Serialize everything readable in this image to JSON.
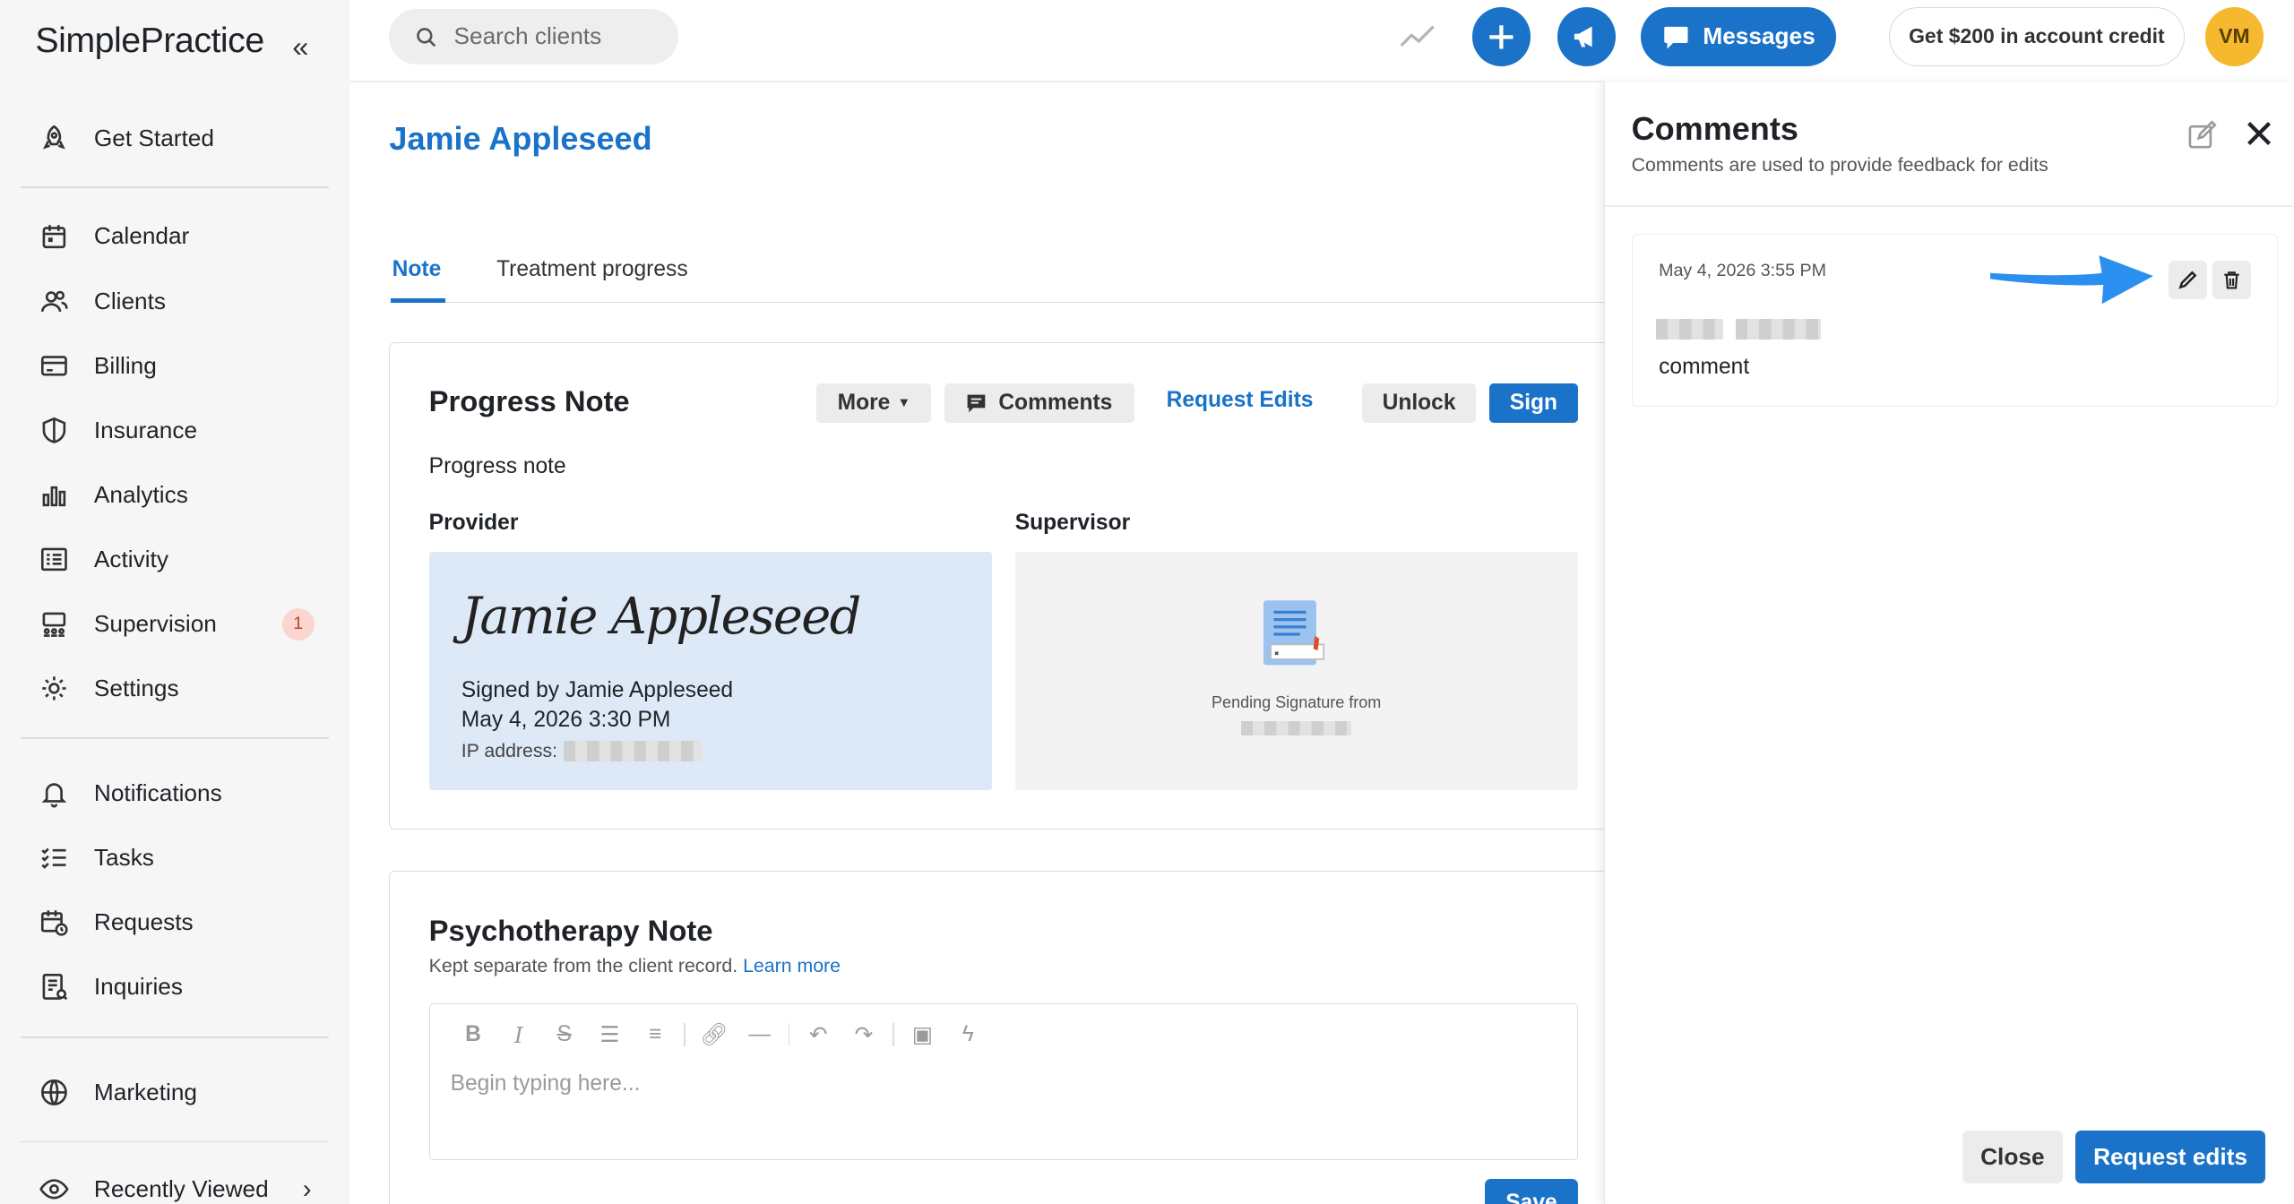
{
  "app": {
    "logo_text": "SimplePractice"
  },
  "sidebar": {
    "items": [
      {
        "label": "Get Started",
        "icon": "rocket-icon"
      },
      {
        "label": "Calendar",
        "icon": "calendar-icon"
      },
      {
        "label": "Clients",
        "icon": "users-icon"
      },
      {
        "label": "Billing",
        "icon": "credit-card-icon"
      },
      {
        "label": "Insurance",
        "icon": "shield-icon"
      },
      {
        "label": "Analytics",
        "icon": "bar-chart-icon"
      },
      {
        "label": "Activity",
        "icon": "list-icon"
      },
      {
        "label": "Supervision",
        "icon": "supervision-icon",
        "badge": "1"
      },
      {
        "label": "Settings",
        "icon": "gear-icon"
      },
      {
        "label": "Notifications",
        "icon": "bell-icon"
      },
      {
        "label": "Tasks",
        "icon": "checklist-icon"
      },
      {
        "label": "Requests",
        "icon": "calendar-clock-icon"
      },
      {
        "label": "Inquiries",
        "icon": "inquiry-icon"
      },
      {
        "label": "Marketing",
        "icon": "globe-icon"
      },
      {
        "label": "Recently Viewed",
        "icon": "eye-icon"
      }
    ]
  },
  "topbar": {
    "search_placeholder": "Search clients",
    "messages_label": "Messages",
    "credit_label": "Get $200 in account credit",
    "avatar_initials": "VM"
  },
  "client": {
    "name": "Jamie Appleseed"
  },
  "tabs": [
    {
      "label": "Note"
    },
    {
      "label": "Treatment progress"
    }
  ],
  "progress_note": {
    "title": "Progress Note",
    "more_label": "More",
    "comments_label": "Comments",
    "request_edits_label": "Request Edits",
    "unlock_label": "Unlock",
    "sign_label": "Sign",
    "subtitle": "Progress note",
    "provider_label": "Provider",
    "supervisor_label": "Supervisor",
    "signature_script": "Jamie Appleseed",
    "signed_by": "Signed by Jamie Appleseed",
    "signed_at": "May 4, 2026 3:30 PM",
    "ip_label": "IP address:",
    "pending_text": "Pending Signature from"
  },
  "psychotherapy_note": {
    "title": "Psychotherapy Note",
    "subtitle": "Kept separate from the client record.",
    "learn_more": "Learn more",
    "placeholder": "Begin typing here...",
    "save_label": "Save"
  },
  "comments_panel": {
    "title": "Comments",
    "subtitle": "Comments are used to provide feedback for edits",
    "comment": {
      "date": "May 4, 2026 3:55 PM",
      "text": "comment"
    },
    "close_label": "Close",
    "request_edits_label": "Request edits"
  },
  "colors": {
    "accent": "#1a73c8",
    "avatar": "#f5b82e",
    "sidebar_bg": "#f6f6f6",
    "provider_box": "#dde9f6"
  }
}
